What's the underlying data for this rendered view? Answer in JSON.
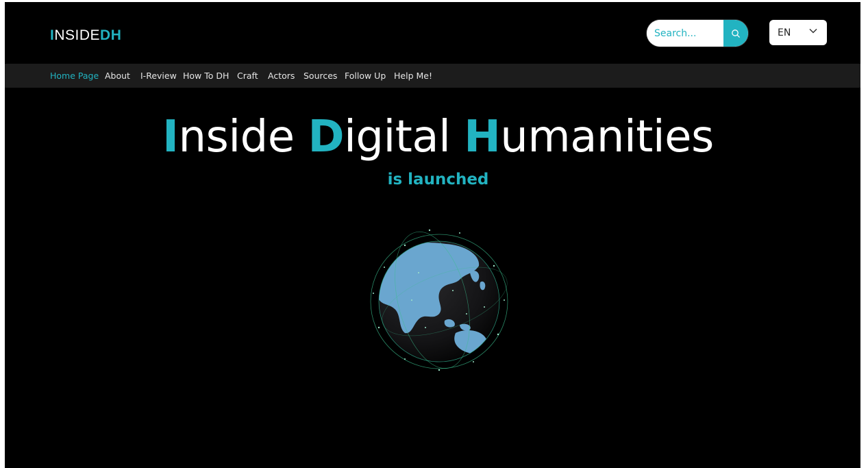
{
  "header": {
    "logo": {
      "first_letter": "I",
      "middle": "NSIDE",
      "suffix": "DH"
    },
    "search": {
      "placeholder": "Search..."
    },
    "language": {
      "selected": "EN"
    }
  },
  "nav": {
    "items": [
      {
        "label": "Home Page",
        "active": true
      },
      {
        "label": "About"
      },
      {
        "label": "I-Review"
      },
      {
        "label": "How To DH"
      },
      {
        "label": "Craft"
      },
      {
        "label": "Actors"
      },
      {
        "label": "Sources"
      },
      {
        "label": "Follow Up"
      },
      {
        "label": "Help Me!"
      }
    ]
  },
  "hero": {
    "title": {
      "w1_cap": "I",
      "w1_rest": "nside",
      "w2_cap": "D",
      "w2_rest": "igital",
      "w3_cap": "H",
      "w3_rest": "umanities"
    },
    "subtitle": "is launched",
    "image": "globe-network-icon"
  },
  "colors": {
    "accent": "#22b3c1",
    "background": "#000000",
    "nav_bg": "#1c1c1c"
  }
}
